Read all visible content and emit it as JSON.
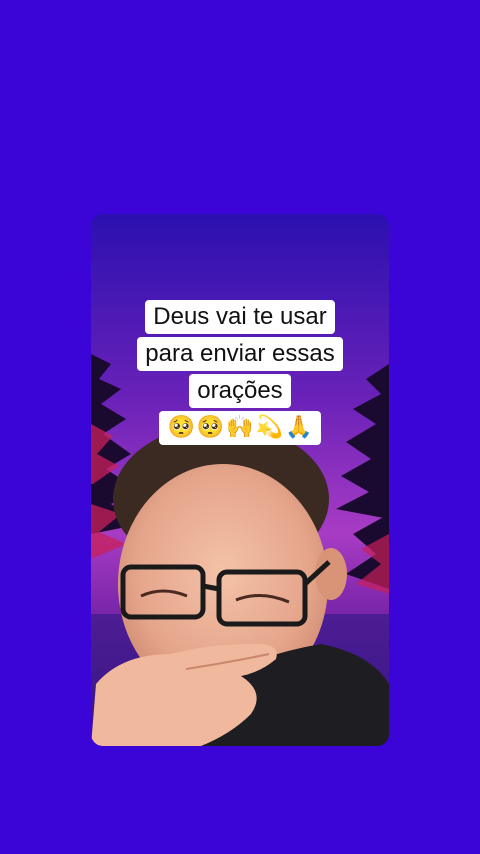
{
  "video": {
    "caption_lines": [
      "Deus vai te usar",
      "para enviar essas",
      "orações"
    ],
    "emojis": [
      "🥺",
      "🥺",
      "🙌",
      "💫",
      "🙏"
    ]
  },
  "colors": {
    "background": "#3a05d6",
    "caption_bg": "#ffffff",
    "caption_text": "#111111"
  }
}
